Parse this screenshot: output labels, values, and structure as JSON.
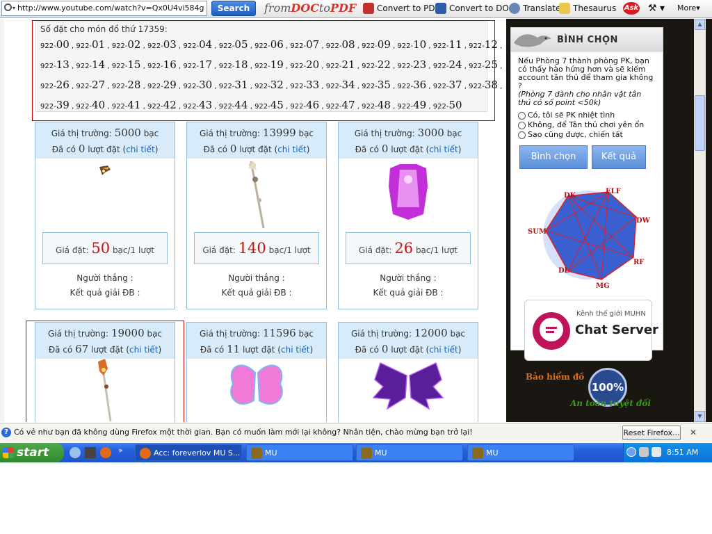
{
  "toolbar": {
    "url": "http://www.youtube.com/watch?v=Qx0U4vi584g",
    "search_label": "Search",
    "fromdoc_a": "from",
    "fromdoc_b": "DOC",
    "fromdoc_c": "to",
    "fromdoc_d": "PDF",
    "convert_pdf": "Convert to PDF",
    "convert_doc": "Convert to DOC",
    "translate": "Translate",
    "thesaurus": "Thesaurus",
    "ask": "Ask",
    "more": "More"
  },
  "sets": {
    "title": "Số đặt cho món đồ thứ 17359:",
    "prefix": "922-",
    "rows": [
      [
        "00",
        "01",
        "02",
        "03",
        "04",
        "05",
        "06",
        "07",
        "08",
        "09",
        "10",
        "11",
        "12"
      ],
      [
        "13",
        "14",
        "15",
        "16",
        "17",
        "18",
        "19",
        "20",
        "21",
        "22",
        "23",
        "24",
        "25"
      ],
      [
        "26",
        "27",
        "28",
        "29",
        "30",
        "31",
        "32",
        "33",
        "34",
        "35",
        "36",
        "37",
        "38"
      ],
      [
        "39",
        "40",
        "41",
        "42",
        "43",
        "44",
        "45",
        "46",
        "47",
        "48",
        "49",
        "50"
      ]
    ]
  },
  "cards": [
    {
      "market_label": "Giá thị trường:",
      "market": "5000",
      "unit": "bạc",
      "count_pre": "Đã có",
      "count": "0",
      "count_post": "lượt đặt (",
      "detail": "chi tiết",
      "close": ")",
      "bid_label": "Giá đặt:",
      "bid": "50",
      "bid_unit": "bạc/1 lượt",
      "winner": "Người thắng :",
      "result": "Kết quả giải ĐB :"
    },
    {
      "market_label": "Giá thị trường:",
      "market": "13999",
      "unit": "bạc",
      "count_pre": "Đã có",
      "count": "0",
      "count_post": "lượt đặt (",
      "detail": "chi tiết",
      "close": ")",
      "bid_label": "Giá đặt:",
      "bid": "140",
      "bid_unit": "bạc/1 lượt",
      "winner": "Người thắng :",
      "result": "Kết quả giải ĐB :"
    },
    {
      "market_label": "Giá thị trường:",
      "market": "3000",
      "unit": "bạc",
      "count_pre": "Đã có",
      "count": "0",
      "count_post": "lượt đặt (",
      "detail": "chi tiết",
      "close": ")",
      "bid_label": "Giá đặt:",
      "bid": "26",
      "bid_unit": "bạc/1 lượt",
      "winner": "Người thắng :",
      "result": "Kết quả giải ĐB :"
    },
    {
      "market_label": "Giá thị trường:",
      "market": "19000",
      "unit": "bạc",
      "count_pre": "Đã có",
      "count": "67",
      "count_post": "lượt đặt (",
      "detail": "chi tiết",
      "close": ")"
    },
    {
      "market_label": "Giá thị trường:",
      "market": "11596",
      "unit": "bạc",
      "count_pre": "Đã có",
      "count": "11",
      "count_post": "lượt đặt (",
      "detail": "chi tiết",
      "close": ")"
    },
    {
      "market_label": "Giá thị trường:",
      "market": "12000",
      "unit": "bạc",
      "count_pre": "Đã có",
      "count": "0",
      "count_post": "lượt đặt (",
      "detail": "chi tiết",
      "close": ")"
    }
  ],
  "poll": {
    "title": "BÌNH CHỌN",
    "question": "Nếu Phòng 7 thành phòng PK, bạn có thấy hào hứng hơn và sẽ kiếm account tân thủ để tham gia không ?",
    "note": "(Phòng 7 dành cho nhân vật tân thủ có số point <50k)",
    "options": [
      "Có, tôi sẽ PK nhiệt tình",
      "Không, để Tân thủ chơi yên ổn",
      "Sao cũng được, chiến tất"
    ],
    "vote_label": "Bình chọn",
    "result_label": "Kết quả"
  },
  "classes": {
    "dk": "DK",
    "elf": "ELF",
    "dw": "DW",
    "sum": "SUM",
    "rf": "RF",
    "dl": "DL",
    "mg": "MG"
  },
  "chat": {
    "top": "Kênh thế giới MUHN",
    "main": "Chat Server"
  },
  "insurance": {
    "top": "Bảo hiểm đồ",
    "pct": "100%",
    "bottom": "An toàn tuyệt đối"
  },
  "notification": {
    "text": "Có vẻ như bạn đã không dùng Firefox một thời gian. Bạn có muốn làm mới lại không? Nhân tiện, chào mừng bạn trở lại!",
    "reset_label": "Reset Firefox...",
    "close": "✕"
  },
  "taskbar": {
    "start": "start",
    "tasks": [
      "Acc: foreverlov MU S...",
      "MU",
      "MU",
      "MU"
    ],
    "clock": "8:51 AM"
  },
  "colors": {
    "accent": "#1a5fb4",
    "price_red": "#c81010",
    "card_border": "#8fc0df",
    "card_head": "#d7ebfa"
  }
}
